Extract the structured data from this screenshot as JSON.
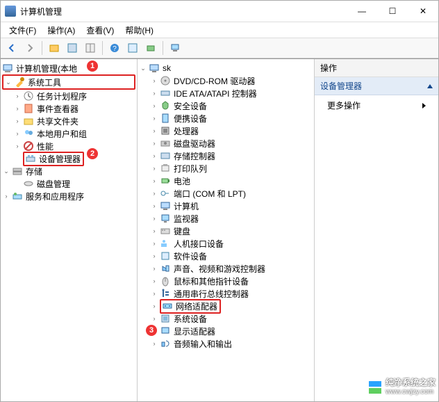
{
  "title": "计算机管理",
  "menus": {
    "file": "文件(F)",
    "action": "操作(A)",
    "view": "查看(V)",
    "help": "帮助(H)"
  },
  "callouts": {
    "c1": "1",
    "c2": "2",
    "c3": "3"
  },
  "left": {
    "root": "计算机管理(本地",
    "systools": "系统工具",
    "st_items": [
      "任务计划程序",
      "事件查看器",
      "共享文件夹",
      "本地用户和组",
      "性能",
      "设备管理器"
    ],
    "storage": "存储",
    "storage_items": [
      "磁盘管理"
    ],
    "services": "服务和应用程序"
  },
  "mid": {
    "root": "sk",
    "items": [
      "DVD/CD-ROM 驱动器",
      "IDE ATA/ATAPI 控制器",
      "安全设备",
      "便携设备",
      "处理器",
      "磁盘驱动器",
      "存储控制器",
      "打印队列",
      "电池",
      "端口 (COM 和 LPT)",
      "计算机",
      "监视器",
      "键盘",
      "人机接口设备",
      "软件设备",
      "声音、视频和游戏控制器",
      "鼠标和其他指针设备",
      "通用串行总线控制器",
      "网络适配器",
      "系统设备",
      "显示适配器",
      "音频输入和输出"
    ]
  },
  "right": {
    "head": "操作",
    "blue": "设备管理器",
    "more": "更多操作"
  },
  "wm": {
    "name": "纯净系统之家",
    "url": "www.cwjzy.com"
  }
}
